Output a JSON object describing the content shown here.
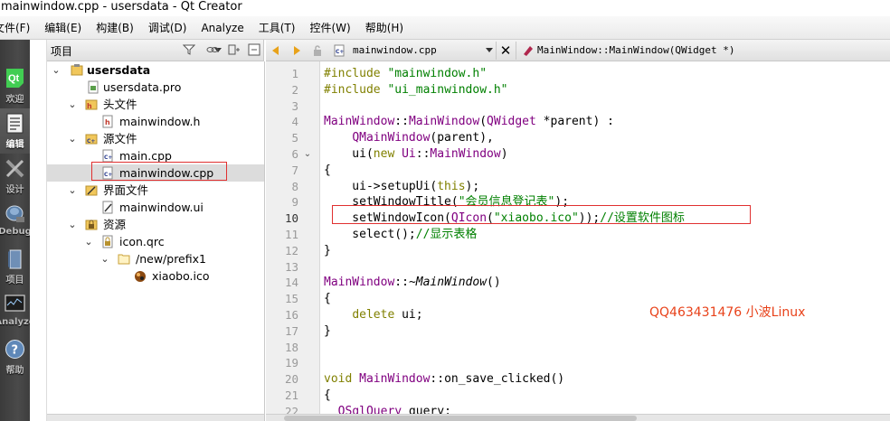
{
  "window": {
    "title": "mainwindow.cpp - usersdata - Qt Creator"
  },
  "menubar": {
    "items": [
      "文件(F)",
      "编辑(E)",
      "构建(B)",
      "调试(D)",
      "Analyze",
      "工具(T)",
      "控件(W)",
      "帮助(H)"
    ]
  },
  "modes": [
    {
      "label": "欢迎",
      "icon": "qt-logo-icon"
    },
    {
      "label": "编辑",
      "icon": "edit-document-icon"
    },
    {
      "label": "设计",
      "icon": "design-tools-icon"
    },
    {
      "label": "Debug",
      "icon": "debug-bug-icon"
    },
    {
      "label": "项目",
      "icon": "project-book-icon"
    },
    {
      "label": "Analyze",
      "icon": "analyze-monitor-icon"
    },
    {
      "label": "帮助",
      "icon": "help-question-icon"
    }
  ],
  "project_pane": {
    "title": "项目",
    "tree": [
      {
        "label": "usersdata",
        "icon": "project-folder-icon",
        "expanded": true,
        "bold": true
      },
      {
        "label": "usersdata.pro",
        "icon": "pro-file-icon"
      },
      {
        "label": "头文件",
        "icon": "header-folder-icon",
        "expanded": true
      },
      {
        "label": "mainwindow.h",
        "icon": "header-file-icon"
      },
      {
        "label": "源文件",
        "icon": "source-folder-icon",
        "expanded": true
      },
      {
        "label": "main.cpp",
        "icon": "cpp-file-icon"
      },
      {
        "label": "mainwindow.cpp",
        "icon": "cpp-file-icon",
        "selected": true
      },
      {
        "label": "界面文件",
        "icon": "form-folder-icon",
        "expanded": true
      },
      {
        "label": "mainwindow.ui",
        "icon": "ui-file-icon"
      },
      {
        "label": "资源",
        "icon": "resource-folder-icon",
        "expanded": true
      },
      {
        "label": "icon.qrc",
        "icon": "qrc-file-icon",
        "expanded": true
      },
      {
        "label": "/new/prefix1",
        "icon": "prefix-folder-icon",
        "expanded": true
      },
      {
        "label": "xiaobo.ico",
        "icon": "ico-file-icon"
      }
    ]
  },
  "editor": {
    "open_file": "mainwindow.cpp",
    "symbol": "MainWindow::MainWindow(QWidget *)",
    "line_numbers": [
      "1",
      "2",
      "3",
      "4",
      "5",
      "6",
      "7",
      "8",
      "9",
      "10",
      "11",
      "12",
      "13",
      "14",
      "15",
      "16",
      "17",
      "18",
      "19",
      "20",
      "21",
      "22"
    ],
    "current_line": "10",
    "lines": [
      "#include \"mainwindow.h\"",
      "#include \"ui_mainwindow.h\"",
      "",
      "MainWindow::MainWindow(QWidget *parent) :",
      "    QMainWindow(parent),",
      "    ui(new Ui::MainWindow)",
      "{",
      "    ui->setupUi(this);",
      "    setWindowTitle(\"会员信息登记表\");",
      "    setWindowIcon(QIcon(\"xiaobo.ico\"));//设置软件图标",
      "    select();//显示表格",
      "}",
      "",
      "MainWindow::~MainWindow()",
      "{",
      "    delete ui;",
      "}",
      "",
      "",
      "void MainWindow::on_save_clicked()",
      "{",
      "  QSqlQuery query;"
    ]
  },
  "watermark": "QQ463431476 小波Linux",
  "colors": {
    "highlight_box": "#e03030",
    "watermark": "#e8421a",
    "keyword": "#808000",
    "string": "#008000",
    "class": "#800080"
  }
}
